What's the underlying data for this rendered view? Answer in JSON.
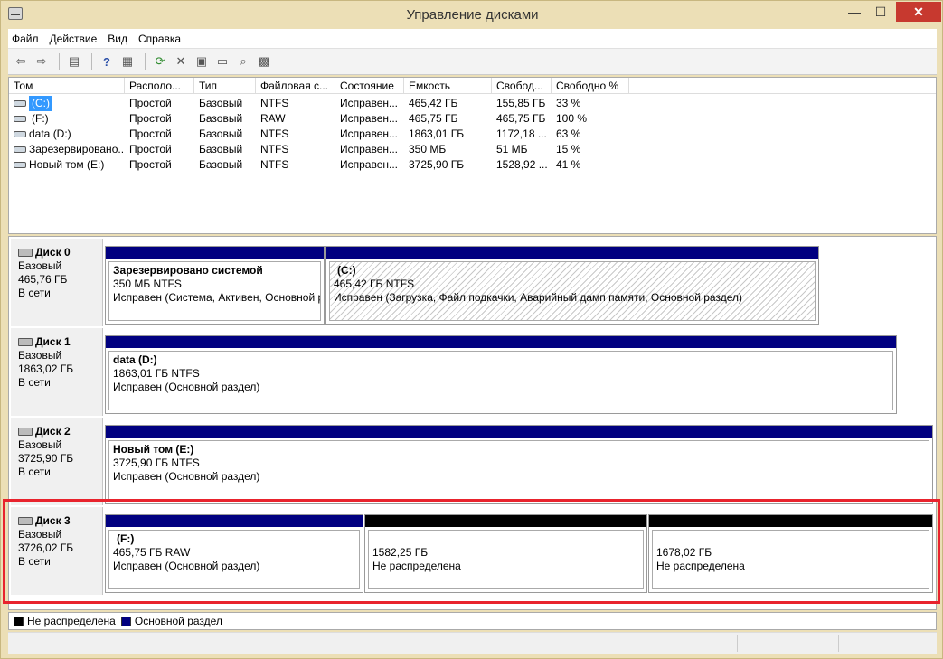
{
  "window": {
    "title": "Управление дисками"
  },
  "menu": [
    "Файл",
    "Действие",
    "Вид",
    "Справка"
  ],
  "columns": [
    "Том",
    "Располо...",
    "Тип",
    "Файловая с...",
    "Состояние",
    "Емкость",
    "Свобод...",
    "Свободно %"
  ],
  "volumes": [
    {
      "name": "(C:)",
      "layout": "Простой",
      "type": "Базовый",
      "fs": "NTFS",
      "status": "Исправен...",
      "capacity": "465,42 ГБ",
      "free": "155,85 ГБ",
      "pct": "33 %"
    },
    {
      "name": "(F:)",
      "layout": "Простой",
      "type": "Базовый",
      "fs": "RAW",
      "status": "Исправен...",
      "capacity": "465,75 ГБ",
      "free": "465,75 ГБ",
      "pct": "100 %"
    },
    {
      "name": "data (D:)",
      "layout": "Простой",
      "type": "Базовый",
      "fs": "NTFS",
      "status": "Исправен...",
      "capacity": "1863,01 ГБ",
      "free": "1172,18 ...",
      "pct": "63 %"
    },
    {
      "name": "Зарезервировано...",
      "layout": "Простой",
      "type": "Базовый",
      "fs": "NTFS",
      "status": "Исправен...",
      "capacity": "350 МБ",
      "free": "51 МБ",
      "pct": "15 %"
    },
    {
      "name": "Новый том (E:)",
      "layout": "Простой",
      "type": "Базовый",
      "fs": "NTFS",
      "status": "Исправен...",
      "capacity": "3725,90 ГБ",
      "free": "1528,92 ...",
      "pct": "41 %"
    }
  ],
  "disks": [
    {
      "name": "Диск 0",
      "type": "Базовый",
      "size": "465,76 ГБ",
      "state": "В сети",
      "parts": [
        {
          "title": "Зарезервировано системой",
          "size": "350 МБ NTFS",
          "status": "Исправен (Система, Активен, Основной р"
        },
        {
          "title": "(C:)",
          "size": "465,42 ГБ NTFS",
          "status": "Исправен (Загрузка, Файл подкачки, Аварийный дамп памяти, Основной раздел)"
        }
      ]
    },
    {
      "name": "Диск 1",
      "type": "Базовый",
      "size": "1863,02 ГБ",
      "state": "В сети",
      "parts": [
        {
          "title": "data  (D:)",
          "size": "1863,01 ГБ NTFS",
          "status": "Исправен (Основной раздел)"
        }
      ]
    },
    {
      "name": "Диск 2",
      "type": "Базовый",
      "size": "3725,90 ГБ",
      "state": "В сети",
      "parts": [
        {
          "title": "Новый том  (E:)",
          "size": "3725,90 ГБ NTFS",
          "status": "Исправен (Основной раздел)"
        }
      ]
    },
    {
      "name": "Диск 3",
      "type": "Базовый",
      "size": "3726,02 ГБ",
      "state": "В сети",
      "parts": [
        {
          "title": "(F:)",
          "size": "465,75 ГБ RAW",
          "status": "Исправен (Основной раздел)"
        },
        {
          "title": "",
          "size": "1582,25 ГБ",
          "status": "Не распределена"
        },
        {
          "title": "",
          "size": "1678,02 ГБ",
          "status": "Не распределена"
        }
      ]
    }
  ],
  "legend": {
    "unallocated": "Не распределена",
    "primary": "Основной раздел"
  },
  "colors": {
    "primary": "#010080",
    "unallocated": "#000000",
    "highlight": "#e8232d"
  }
}
